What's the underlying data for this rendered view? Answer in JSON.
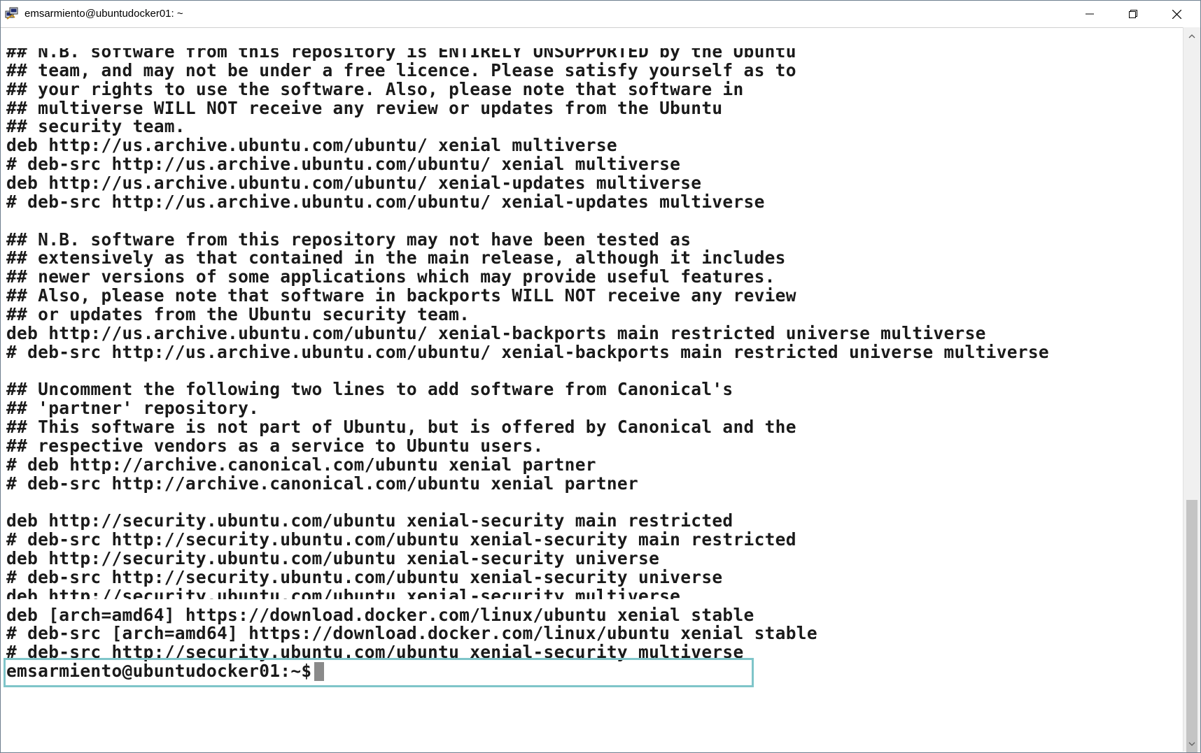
{
  "window": {
    "title": "emsarmiento@ubuntudocker01: ~"
  },
  "terminal": {
    "lines": [
      "## N.B. software from this repository is ENTIRELY UNSUPPORTED by the Ubuntu",
      "## team, and may not be under a free licence. Please satisfy yourself as to",
      "## your rights to use the software. Also, please note that software in",
      "## multiverse WILL NOT receive any review or updates from the Ubuntu",
      "## security team.",
      "deb http://us.archive.ubuntu.com/ubuntu/ xenial multiverse",
      "# deb-src http://us.archive.ubuntu.com/ubuntu/ xenial multiverse",
      "deb http://us.archive.ubuntu.com/ubuntu/ xenial-updates multiverse",
      "# deb-src http://us.archive.ubuntu.com/ubuntu/ xenial-updates multiverse",
      "",
      "## N.B. software from this repository may not have been tested as",
      "## extensively as that contained in the main release, although it includes",
      "## newer versions of some applications which may provide useful features.",
      "## Also, please note that software in backports WILL NOT receive any review",
      "## or updates from the Ubuntu security team.",
      "deb http://us.archive.ubuntu.com/ubuntu/ xenial-backports main restricted universe multiverse",
      "# deb-src http://us.archive.ubuntu.com/ubuntu/ xenial-backports main restricted universe multiverse",
      "",
      "## Uncomment the following two lines to add software from Canonical's",
      "## 'partner' repository.",
      "## This software is not part of Ubuntu, but is offered by Canonical and the",
      "## respective vendors as a service to Ubuntu users.",
      "# deb http://archive.canonical.com/ubuntu xenial partner",
      "# deb-src http://archive.canonical.com/ubuntu xenial partner",
      "",
      "deb http://security.ubuntu.com/ubuntu xenial-security main restricted",
      "# deb-src http://security.ubuntu.com/ubuntu xenial-security main restricted",
      "deb http://security.ubuntu.com/ubuntu xenial-security universe",
      "# deb-src http://security.ubuntu.com/ubuntu xenial-security universe",
      "deb http://security.ubuntu.com/ubuntu xenial-security multiverse",
      "deb [arch=amd64] https://download.docker.com/linux/ubuntu xenial stable",
      "# deb-src [arch=amd64] https://download.docker.com/linux/ubuntu xenial stable",
      "# deb-src http://security.ubuntu.com/ubuntu xenial-security multiverse"
    ],
    "prompt": "emsarmiento@ubuntudocker01:~$",
    "highlighted_line_index": 30,
    "highlight_color": "#7fc5c9",
    "text_color": "#1a1a1a",
    "background_color": "#ffffff"
  },
  "icons": {
    "app": "putty-app-icon",
    "minimize": "minimize-icon",
    "restore": "restore-icon",
    "close": "close-icon",
    "scroll_up": "chevron-up-icon",
    "scroll_down": "chevron-down-icon"
  }
}
